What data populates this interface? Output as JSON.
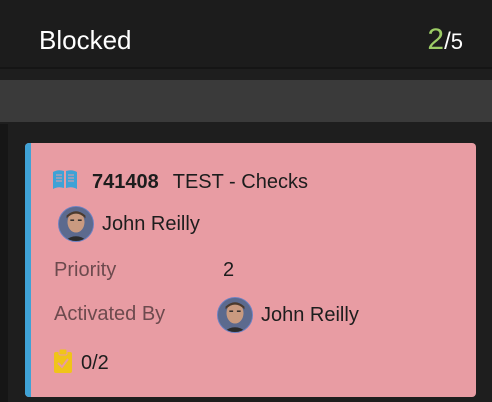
{
  "column": {
    "title": "Blocked",
    "count_current": "2",
    "count_separator": "/",
    "count_limit": "5"
  },
  "card": {
    "id": "741408",
    "title": "TEST - Checks",
    "type_icon": "book-icon",
    "assignee": {
      "name": "John Reilly",
      "icon": "avatar"
    },
    "fields": {
      "priority_label": "Priority",
      "priority_value": "2",
      "activated_by_label": "Activated By",
      "activated_by_value": "John Reilly"
    },
    "checklist": {
      "icon": "clipboard-check-icon",
      "progress": "0/2"
    }
  },
  "colors": {
    "background": "#1e1e1e",
    "card_background": "#e89ca3",
    "card_accent": "#3fa2d6",
    "count_accent": "#9ccc65",
    "checklist_icon": "#f0c419"
  }
}
